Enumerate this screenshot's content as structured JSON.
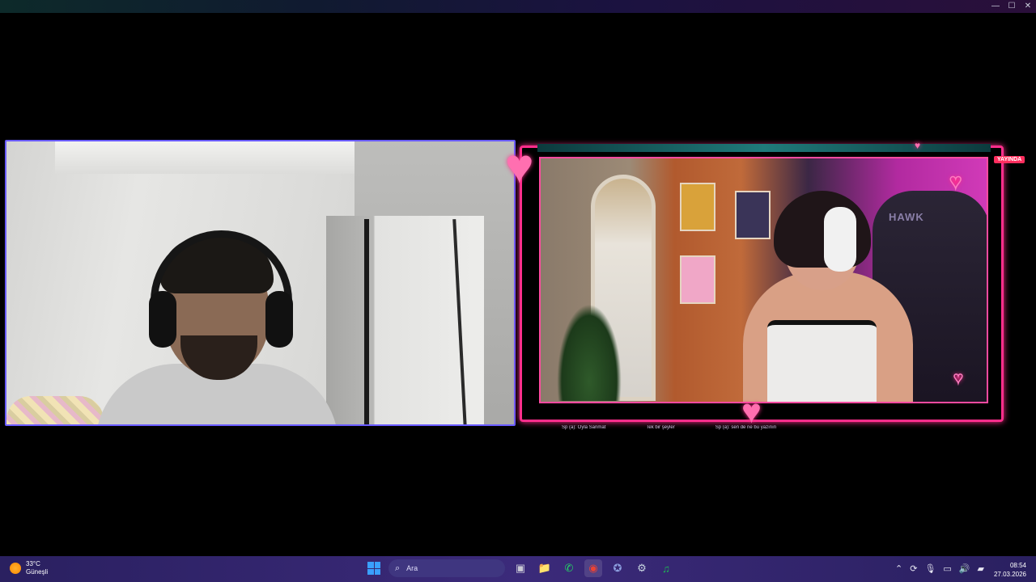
{
  "window": {
    "controls": {
      "minimize": "—",
      "maximize": "☐",
      "close": "✕"
    }
  },
  "stream": {
    "live_badge": "YAYINDA",
    "chair_brand": "HAWK",
    "chat_messages": [
      "Sp (a): Oyla Sanmat",
      "Tek bir şeyler",
      "Sp (a): sen de ne bu yazının"
    ]
  },
  "taskbar": {
    "weather": {
      "temp": "33°C",
      "condition": "Güneşli"
    },
    "search_placeholder": "Ara",
    "apps": [
      {
        "name": "task-view",
        "glyph": "▣",
        "color": "#c9c9d6"
      },
      {
        "name": "file-explorer",
        "glyph": "📁",
        "color": "#f4c542"
      },
      {
        "name": "whatsapp",
        "glyph": "✆",
        "color": "#25d366"
      },
      {
        "name": "chrome",
        "glyph": "◉",
        "color": "#ea4335"
      },
      {
        "name": "discord",
        "glyph": "✪",
        "color": "#7289da"
      },
      {
        "name": "steam",
        "glyph": "⚙",
        "color": "#c7d5e0"
      },
      {
        "name": "spotify",
        "glyph": "♫",
        "color": "#1db954"
      }
    ],
    "tray_icons": [
      "chevron-up-icon",
      "sync-icon",
      "microphone-icon",
      "display-icon",
      "volume-icon",
      "battery-icon"
    ],
    "clock": {
      "time": "08:54",
      "date": "27.03.2026"
    }
  }
}
